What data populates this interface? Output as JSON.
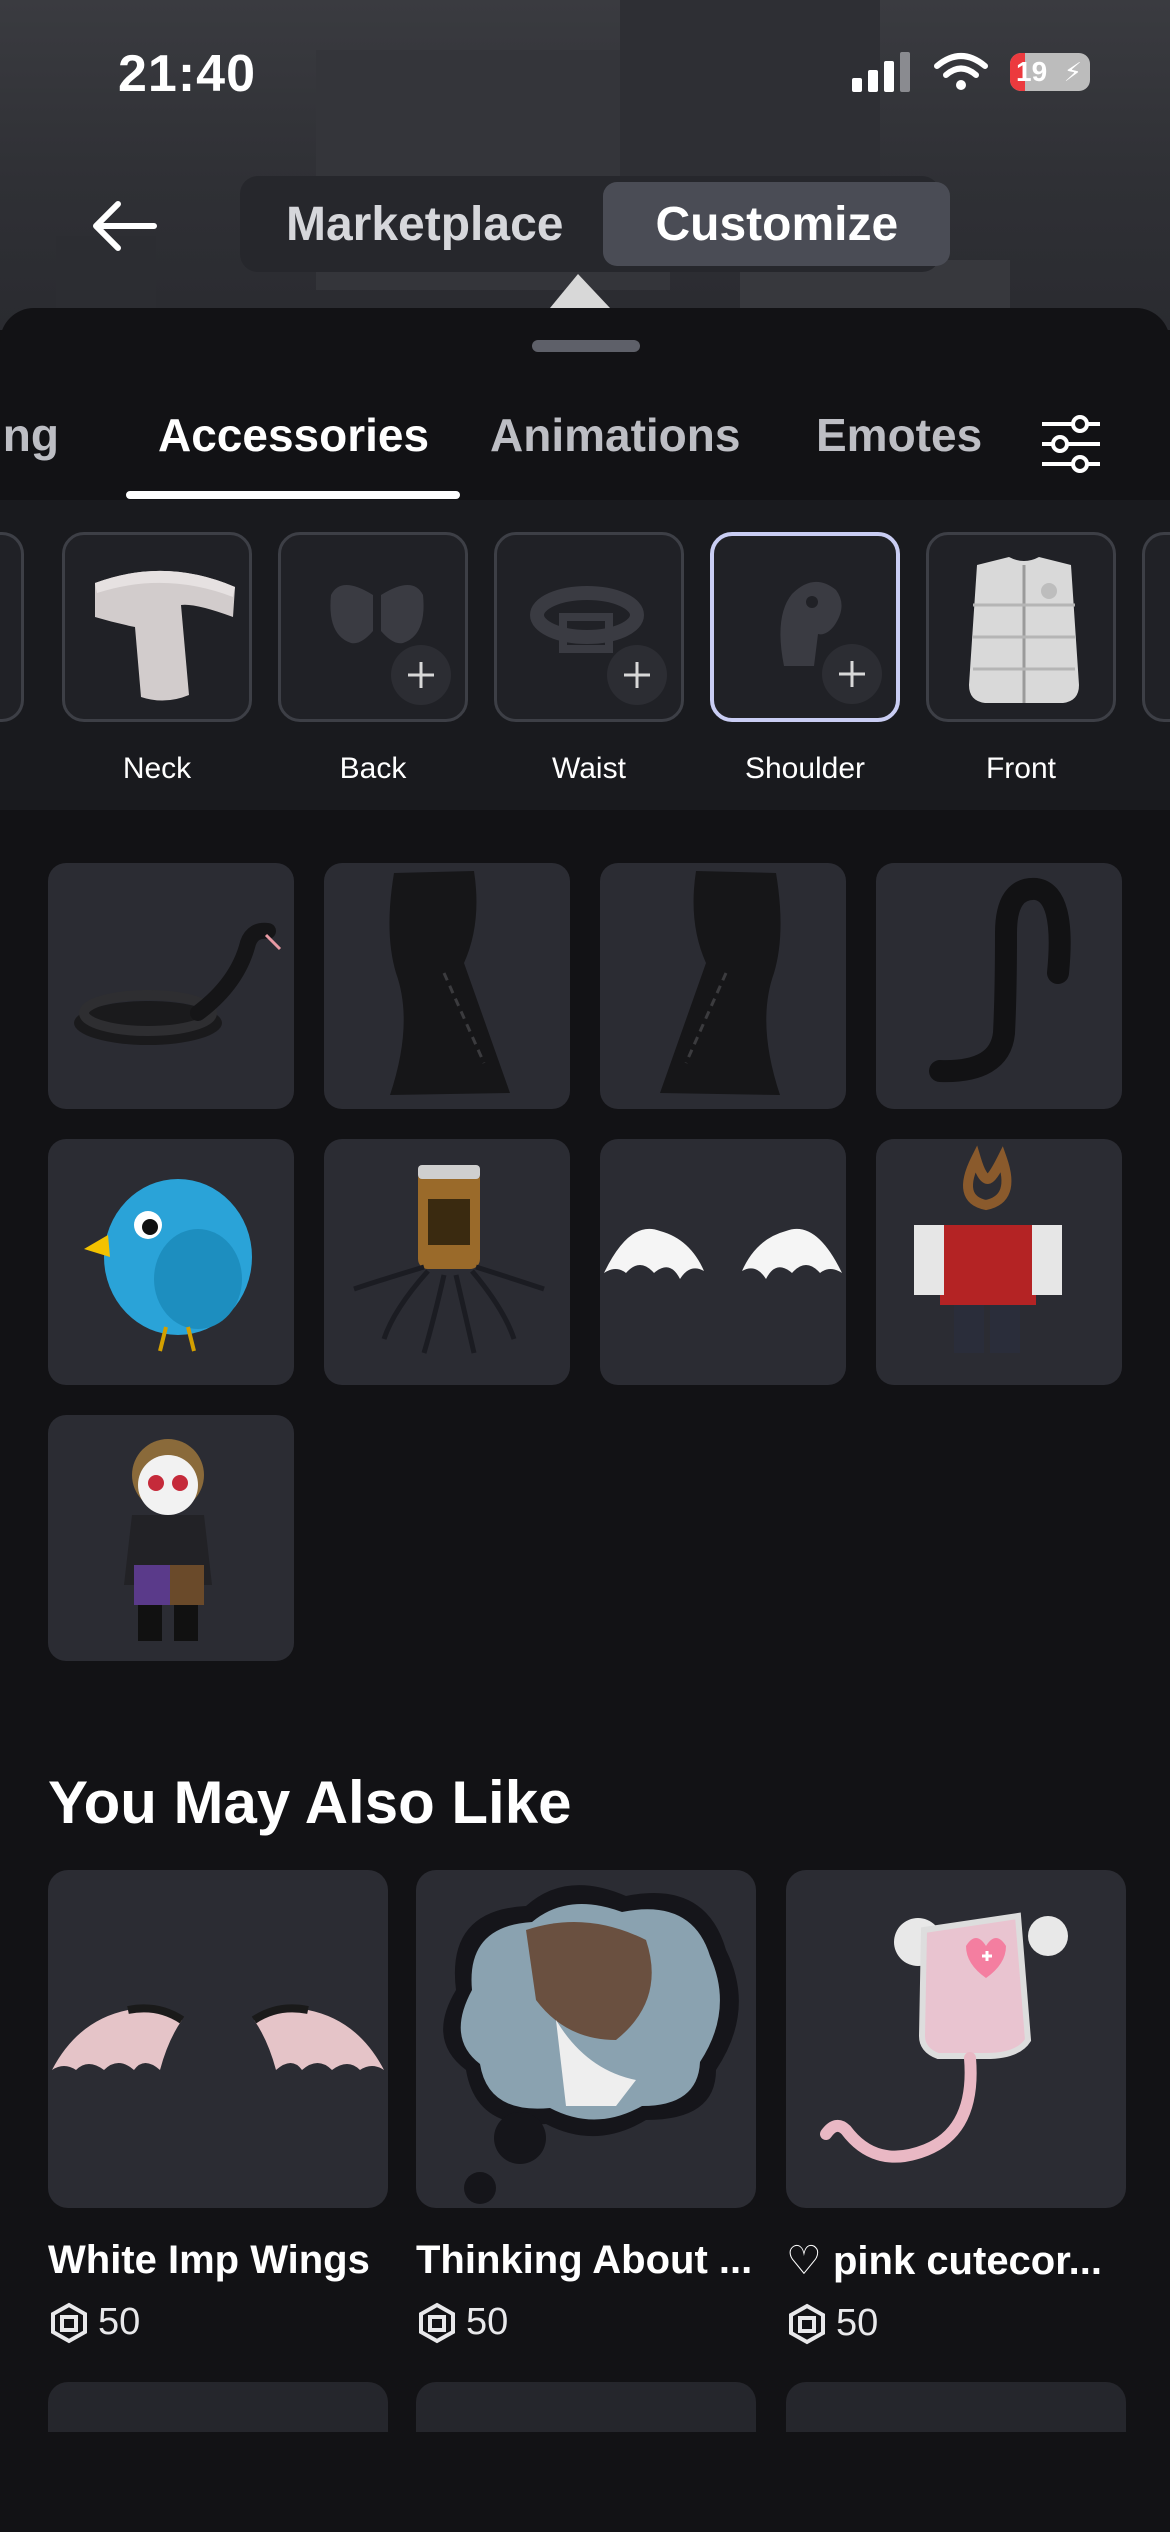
{
  "status_bar": {
    "time": "21:40",
    "battery_percent": "19",
    "battery_level": 0.19
  },
  "top_nav": {
    "tabs": [
      "Marketplace",
      "Customize"
    ],
    "active": "Customize"
  },
  "category_tabs": [
    "ing",
    "Accessories",
    "Animations",
    "Emotes"
  ],
  "active_category": "Accessories",
  "slots": [
    {
      "label": "Neck",
      "filled": true
    },
    {
      "label": "Back",
      "filled": false
    },
    {
      "label": "Waist",
      "filled": false
    },
    {
      "label": "Shoulder",
      "filled": false,
      "selected": true
    },
    {
      "label": "Front",
      "filled": true
    }
  ],
  "items": [
    {
      "icon": "snake-accessory-icon"
    },
    {
      "icon": "left-boot-accessory-icon"
    },
    {
      "icon": "right-boot-accessory-icon"
    },
    {
      "icon": "tail-accessory-icon"
    },
    {
      "icon": "blue-bird-accessory-icon"
    },
    {
      "icon": "spider-jar-accessory-icon"
    },
    {
      "icon": "white-wings-accessory-icon"
    },
    {
      "icon": "pretzel-shirt-accessory-icon"
    },
    {
      "icon": "mini-figure-accessory-icon"
    }
  ],
  "recommendations": {
    "title": "You May Also Like",
    "items": [
      {
        "name": "White Imp Wings",
        "price": "50"
      },
      {
        "name": "Thinking About ...",
        "price": "50"
      },
      {
        "name": "♡ pink cutecor...",
        "price": "50"
      }
    ]
  },
  "colors": {
    "background": "#121215",
    "tile": "#2b2c33",
    "selected_border": "#c9cdf3"
  }
}
